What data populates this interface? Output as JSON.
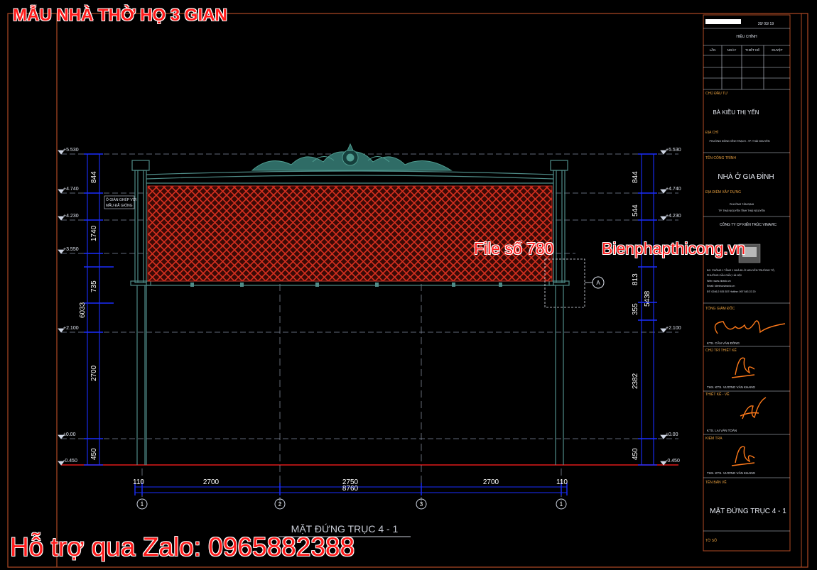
{
  "overlay": {
    "title": "MẪU NHÀ THỜ HỌ 3 GIAN",
    "file_label": "File số 780",
    "site_label": "Bienphapthicong.vn",
    "support_label": "Hỗ trợ qua Zalo: 0965882388"
  },
  "drawing": {
    "view_title": "MẶT ĐỨNG TRỤC 4 - 1",
    "left_levels": [
      "+5.530",
      "+4.740",
      "+4.230",
      "+3.550",
      "+2.100",
      "±0.00",
      "-0.450"
    ],
    "right_levels": [
      "+5.530",
      "+4.740",
      "+4.230",
      "+2.100",
      "±0.00",
      "-0.450"
    ],
    "left_dims": {
      "d844": "844",
      "d1740": "1740",
      "d735": "735",
      "d2700": "2700",
      "d450": "450",
      "total": "6033"
    },
    "right_dims": {
      "d844": "844",
      "d544": "544",
      "d813": "813",
      "d355": "355",
      "d2382": "2382",
      "d450": "450",
      "total": "5438"
    },
    "note": [
      "Ô GIÁN GHÉP VỚI",
      "MÃU ĐÃ GIÓNG"
    ],
    "bottom_dims": {
      "a": "110",
      "b": "2700",
      "c": "2750",
      "d": "2700",
      "e": "110",
      "total": "8760"
    },
    "axes": [
      "1",
      "2",
      "3",
      "1"
    ],
    "detail_tag": "A"
  },
  "title_block": {
    "date": "20/ 03/ 19",
    "revision_header": "HIỆU CHỈNH",
    "rev_cols": [
      "LẦN",
      "NGÀY",
      "THIẾT KẾ",
      "DUYỆT"
    ],
    "owner_label": "CHỦ ĐẦU TƯ",
    "owner": "BÀ KIỀU THỊ YẾN",
    "address_label": "ĐỊA CHỈ",
    "address": "PHƯỜNG ĐÔNG VĨNH TRẠCH - TP. THÁI NGUYÊN",
    "project_label": "TÊN CÔNG TRÌNH",
    "project": "NHÀ Ở GIA ĐÌNH",
    "location_label": "ĐỊA ĐIỂM XÂY DỰNG",
    "location": [
      "PHƯỜNG TÂN ĐỊNH",
      "TP. THÁI NGUYÊN TỈNH THÁI NGUYÊN"
    ],
    "company": "CÔNG TY CP KIẾN TRÚC VINAVIC",
    "company_info": [
      "ĐC: PHÒNG 1 TẦNG 1 NHÀ B LÔ NGUYỄN TRƯỜNG TỘ,",
      "PHƯỜNG CẦU GIẤY, HÀ NỘI",
      "Web: www.vinavic.vn",
      "Email: kientrucvinavic.vn",
      "ĐT: 0246.2 925 357   Hotline: 097 543 22 20"
    ],
    "director_label": "TỔNG GIÁM ĐỐC",
    "director": "KTS. CẤN VĂN ĐÔNG",
    "chief_label": "CHỦ TRÌ THIẾT KẾ",
    "chief": "THS. KTS. VƯƠNG VĂN KHANG",
    "designer_label": "THIẾT KẾ - VẼ",
    "designer": "KTS. LẠI VĂN TOÀN",
    "checker_label": "KIỂM TRA",
    "checker": "THS. KTS. VƯƠNG VĂN KHANG",
    "sheet_label": "TÊN BẢN VẼ",
    "sheet_name": "MẶT ĐỨNG TRỤC 4 - 1",
    "sheet_no_label": "TỜ SỐ"
  },
  "colors": {
    "frame": "#b04a24",
    "panel": "#c0281c",
    "dim": "#1a2eff",
    "struct": "#4f8c88",
    "ground": "#e01a1a",
    "overlay_text": "#ff1a1a"
  }
}
